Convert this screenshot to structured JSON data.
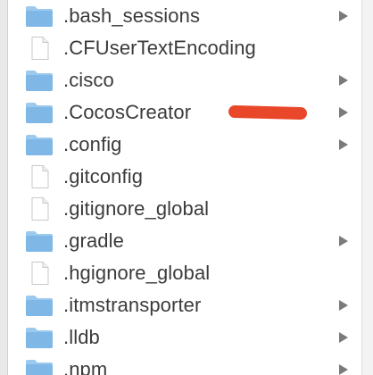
{
  "finder": {
    "items": [
      {
        "name": ".bash_sessions",
        "kind": "folder",
        "expandable": true
      },
      {
        "name": ".CFUserTextEncoding",
        "kind": "file",
        "expandable": false
      },
      {
        "name": ".cisco",
        "kind": "folder",
        "expandable": true
      },
      {
        "name": ".CocosCreator",
        "kind": "folder",
        "expandable": true
      },
      {
        "name": ".config",
        "kind": "folder",
        "expandable": true
      },
      {
        "name": ".gitconfig",
        "kind": "file",
        "expandable": false
      },
      {
        "name": ".gitignore_global",
        "kind": "file",
        "expandable": false
      },
      {
        "name": ".gradle",
        "kind": "folder",
        "expandable": true
      },
      {
        "name": ".hgignore_global",
        "kind": "file",
        "expandable": false
      },
      {
        "name": ".itmstransporter",
        "kind": "folder",
        "expandable": true
      },
      {
        "name": ".lldb",
        "kind": "folder",
        "expandable": true
      },
      {
        "name": ".npm",
        "kind": "folder",
        "expandable": true
      }
    ],
    "icons": {
      "folder": "folder-icon",
      "file": "file-icon",
      "arrow": "disclosure-arrow-icon"
    },
    "colors": {
      "folder": "#7fb8e6",
      "text": "#3b3b3b",
      "arrow": "#7a7a7a",
      "annotation": "#e8472a"
    }
  }
}
